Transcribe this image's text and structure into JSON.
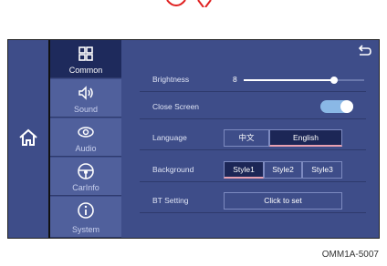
{
  "colors": {
    "panel": "#3e4d89",
    "nav_active": "#1e2a5c",
    "nav_item": "#50609c",
    "toggle_on": "#8ab8e6"
  },
  "nav": {
    "items": [
      {
        "label": "Common",
        "icon": "grid-icon",
        "active": true
      },
      {
        "label": "Sound",
        "icon": "speaker-icon",
        "active": false
      },
      {
        "label": "Audio",
        "icon": "audio-wave-icon",
        "active": false
      },
      {
        "label": "CarInfo",
        "icon": "steering-wheel-icon",
        "active": false
      },
      {
        "label": "System",
        "icon": "info-icon",
        "active": false
      }
    ]
  },
  "home_icon": "home-icon",
  "back_icon": "back-arrow-icon",
  "settings": {
    "brightness": {
      "label": "Brightness",
      "value": "8",
      "level": 0.75
    },
    "close_screen": {
      "label": "Close Screen",
      "on": true
    },
    "language": {
      "label": "Language",
      "options": [
        "中文",
        "English"
      ],
      "selected": "English"
    },
    "background": {
      "label": "Background",
      "options": [
        "Style1",
        "Style2",
        "Style3"
      ],
      "selected": "Style1"
    },
    "bt_setting": {
      "label": "BT Setting",
      "button": "Click to set"
    }
  },
  "caption": "OMM1A-5007"
}
